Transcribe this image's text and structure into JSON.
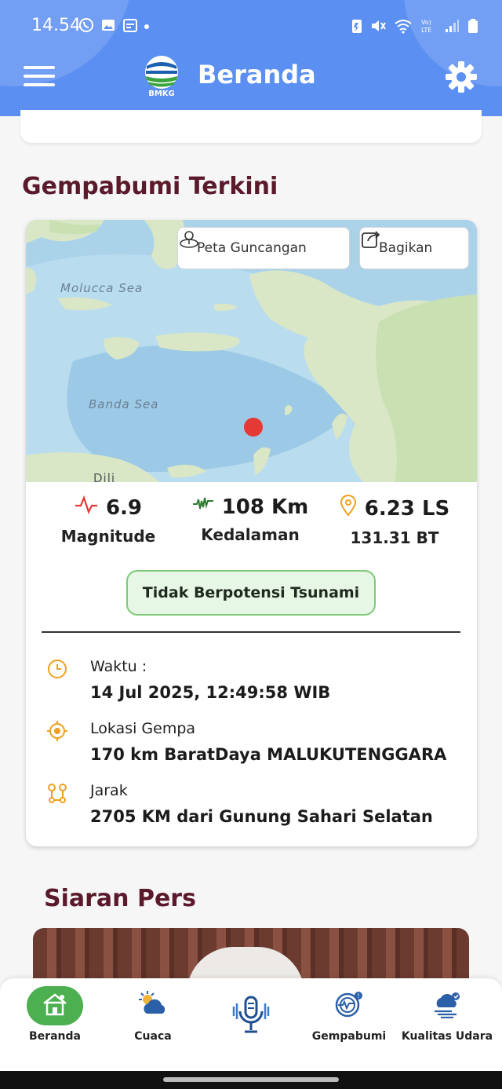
{
  "status": {
    "time": "14.54"
  },
  "header": {
    "title": "Beranda",
    "logo_text": "BMKG",
    "color": "#5b8ff2"
  },
  "quake": {
    "section_title": "Gempabumi Terkini",
    "buttons": {
      "shake_map": "Peta Guncangan",
      "share": "Bagikan"
    },
    "map_labels": {
      "sea1": "Molucca Sea",
      "sea2": "Banda Sea",
      "city": "Dili"
    },
    "magnitude": {
      "value": "6.9",
      "label": "Magnitude"
    },
    "depth": {
      "value": "108 Km",
      "label": "Kedalaman"
    },
    "location": {
      "lat": "6.23 LS",
      "lon": "131.31 BT"
    },
    "tsunami_status": "Tidak Berpotensi Tsunami",
    "details": {
      "time_label": "Waktu :",
      "time_value": "14 Jul 2025, 12:49:58 WIB",
      "location_label": "Lokasi Gempa",
      "location_value": "170 km BaratDaya MALUKUTENGGARA",
      "distance_label": "Jarak",
      "distance_value": "2705 KM dari Gunung Sahari Selatan"
    },
    "accent_colors": {
      "magnitude": "#e53935",
      "depth": "#2e7d32",
      "location": "#f0a020"
    }
  },
  "press": {
    "section_title": "Siaran Pers"
  },
  "nav": {
    "items": [
      {
        "label": "Beranda",
        "icon": "home-icon",
        "active": true
      },
      {
        "label": "Cuaca",
        "icon": "weather-icon"
      },
      {
        "label": "",
        "icon": "microphone-icon"
      },
      {
        "label": "Gempabumi",
        "icon": "earthquake-icon"
      },
      {
        "label": "Kualitas Udara",
        "icon": "air-quality-icon"
      }
    ],
    "active_color": "#4caf50"
  }
}
